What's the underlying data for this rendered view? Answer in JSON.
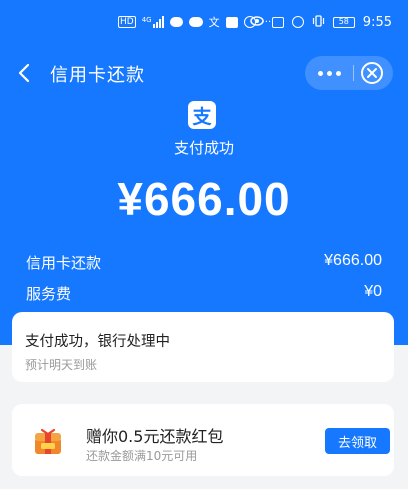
{
  "status_bar": {
    "left_hd": "HD",
    "left_signal": "4G",
    "left_more": "···",
    "battery": "58",
    "time": "9:55"
  },
  "header": {
    "title": "信用卡还款"
  },
  "result": {
    "logo_char": "支",
    "status_text": "支付成功",
    "amount": "¥666.00"
  },
  "details": [
    {
      "label": "信用卡还款",
      "value": "¥666.00"
    },
    {
      "label": "服务费",
      "value": "¥0"
    }
  ],
  "status_card": {
    "title": "支付成功，银行处理中",
    "subtitle": "预计明天到账"
  },
  "promo": {
    "title": "赠你0.5元还款红包",
    "subtitle": "还款金额满10元可用",
    "button_label": "去领取"
  },
  "colors": {
    "accent": "#1678ff",
    "background": "#f2f4f5"
  },
  "icons": [
    "back-arrow-icon",
    "more-icon",
    "close-icon",
    "alipay-logo-icon",
    "gift-box-icon"
  ]
}
